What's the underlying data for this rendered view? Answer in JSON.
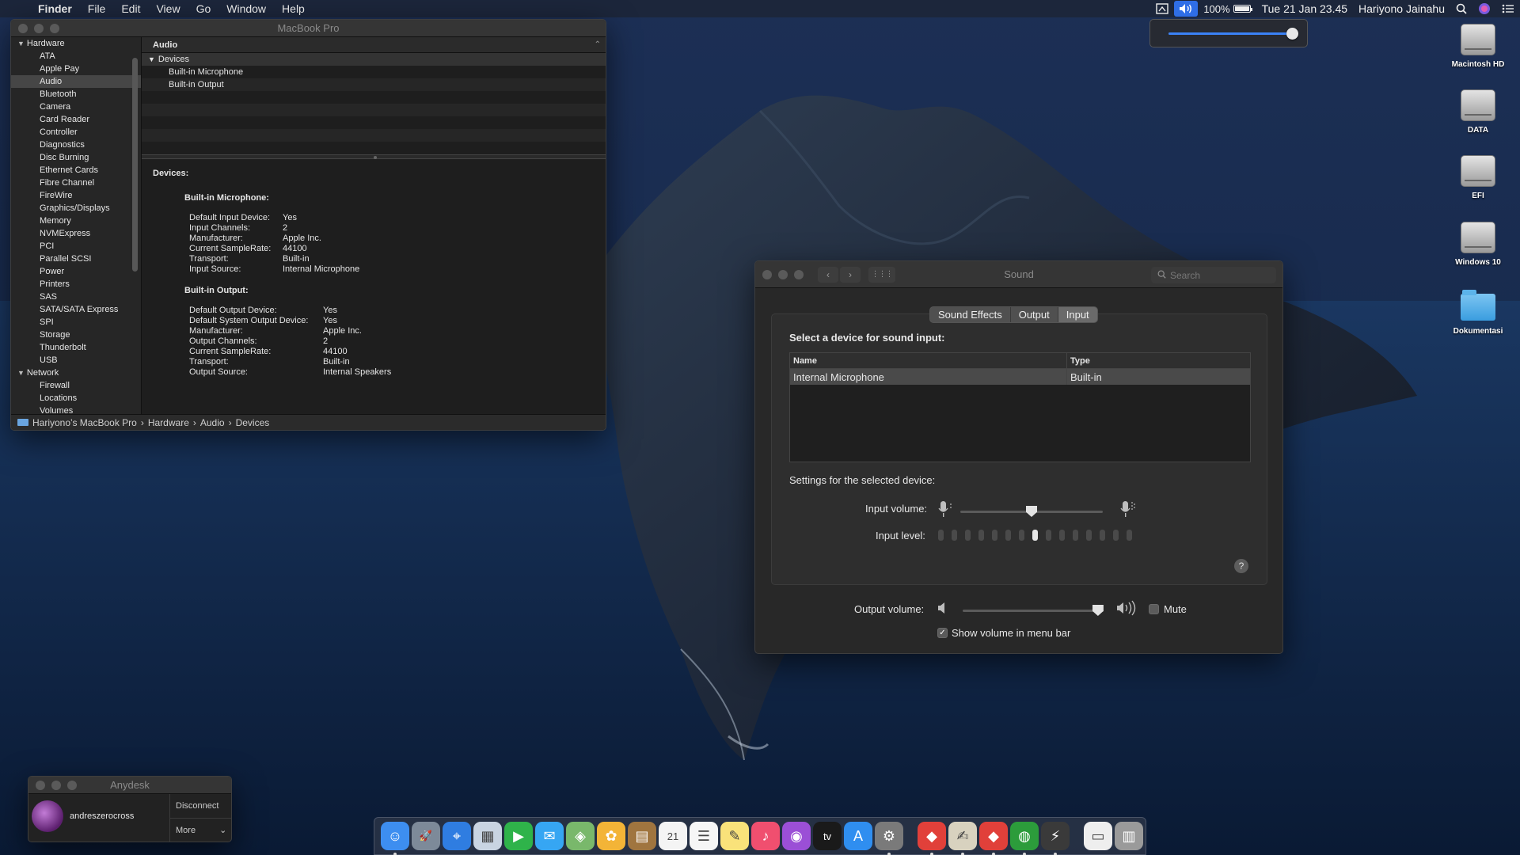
{
  "menubar": {
    "apple": "",
    "items": [
      "Finder",
      "File",
      "Edit",
      "View",
      "Go",
      "Window",
      "Help"
    ],
    "battery": "100%",
    "datetime": "Tue 21 Jan  23.45",
    "user": "Hariyono Jainahu"
  },
  "volume_popup": {
    "level": 0.96
  },
  "desktop_icons": [
    {
      "label": "Macintosh HD",
      "icon": "disk-icon"
    },
    {
      "label": "DATA",
      "icon": "disk-icon"
    },
    {
      "label": "EFI",
      "icon": "disk-icon"
    },
    {
      "label": "Windows 10",
      "icon": "disk-icon"
    },
    {
      "label": "Dokumentasi",
      "icon": "folder-icon"
    }
  ],
  "sysinfo": {
    "title": "MacBook Pro",
    "sidebar": {
      "hardware_label": "Hardware",
      "hardware_items": [
        "ATA",
        "Apple Pay",
        "Audio",
        "Bluetooth",
        "Camera",
        "Card Reader",
        "Controller",
        "Diagnostics",
        "Disc Burning",
        "Ethernet Cards",
        "Fibre Channel",
        "FireWire",
        "Graphics/Displays",
        "Memory",
        "NVMExpress",
        "PCI",
        "Parallel SCSI",
        "Power",
        "Printers",
        "SAS",
        "SATA/SATA Express",
        "SPI",
        "Storage",
        "Thunderbolt",
        "USB"
      ],
      "selected": "Audio",
      "network_label": "Network",
      "network_items": [
        "Firewall",
        "Locations",
        "Volumes"
      ]
    },
    "table": {
      "header": "Audio",
      "group": "Devices",
      "rows": [
        "Built-in Microphone",
        "Built-in Output"
      ]
    },
    "detail": {
      "heading": "Devices:",
      "mic_title": "Built-in Microphone:",
      "mic": [
        [
          "Default Input Device:",
          "Yes"
        ],
        [
          "Input Channels:",
          "2"
        ],
        [
          "Manufacturer:",
          "Apple Inc."
        ],
        [
          "Current SampleRate:",
          "44100"
        ],
        [
          "Transport:",
          "Built-in"
        ],
        [
          "Input Source:",
          "Internal Microphone"
        ]
      ],
      "out_title": "Built-in Output:",
      "out": [
        [
          "Default Output Device:",
          "Yes"
        ],
        [
          "Default System Output Device:",
          "Yes"
        ],
        [
          "Manufacturer:",
          "Apple Inc."
        ],
        [
          "Output Channels:",
          "2"
        ],
        [
          "Current SampleRate:",
          "44100"
        ],
        [
          "Transport:",
          "Built-in"
        ],
        [
          "Output Source:",
          "Internal Speakers"
        ]
      ]
    },
    "path": [
      "Hariyono’s MacBook Pro",
      "Hardware",
      "Audio",
      "Devices"
    ]
  },
  "sound": {
    "title": "Sound",
    "search_placeholder": "Search",
    "tabs": [
      "Sound Effects",
      "Output",
      "Input"
    ],
    "active_tab": "Input",
    "select_label": "Select a device for sound input:",
    "col_name": "Name",
    "col_type": "Type",
    "device_name": "Internal Microphone",
    "device_type": "Built-in",
    "settings_label": "Settings for the selected device:",
    "input_volume_label": "Input volume:",
    "input_volume": 0.5,
    "input_level_label": "Input level:",
    "input_level_segments": 15,
    "input_level_active": 7,
    "help": "?",
    "output_volume_label": "Output volume:",
    "output_volume": 0.96,
    "mute_label": "Mute",
    "mute_checked": false,
    "show_volume_label": "Show volume in menu bar",
    "show_volume_checked": true
  },
  "anydesk": {
    "title": "Anydesk",
    "user": "andreszerocross",
    "disconnect": "Disconnect",
    "more": "More"
  },
  "dock": {
    "apps": [
      {
        "name": "finder-icon",
        "color": "#3d8ef0",
        "glyph": "☺",
        "running": true
      },
      {
        "name": "launchpad-icon",
        "color": "#7d8a99",
        "glyph": "🚀",
        "running": false
      },
      {
        "name": "safari-icon",
        "color": "#2f7de1",
        "glyph": "⌖",
        "running": false
      },
      {
        "name": "preview-icon",
        "color": "#c9d4e2",
        "glyph": "▦",
        "running": false
      },
      {
        "name": "facetime-icon",
        "color": "#2fb34a",
        "glyph": "▶",
        "running": false
      },
      {
        "name": "messages-icon",
        "color": "#36a6f3",
        "glyph": "✉",
        "running": false
      },
      {
        "name": "maps-icon",
        "color": "#79b86b",
        "glyph": "◈",
        "running": false
      },
      {
        "name": "photos-icon",
        "color": "#f3b437",
        "glyph": "✿",
        "running": false
      },
      {
        "name": "notes-book-icon",
        "color": "#a0753f",
        "glyph": "▤",
        "running": false
      },
      {
        "name": "calendar-icon",
        "color": "#f4f4f4",
        "glyph": "21",
        "running": false
      },
      {
        "name": "reminders-icon",
        "color": "#f6f6f6",
        "glyph": "☰",
        "running": false
      },
      {
        "name": "notes-icon",
        "color": "#f9e27a",
        "glyph": "✎",
        "running": false
      },
      {
        "name": "music-icon",
        "color": "#f04f6f",
        "glyph": "♪",
        "running": false
      },
      {
        "name": "podcasts-icon",
        "color": "#9b4fd6",
        "glyph": "◉",
        "running": false
      },
      {
        "name": "tv-icon",
        "color": "#1a1a1a",
        "glyph": "tv",
        "running": false
      },
      {
        "name": "app-store-icon",
        "color": "#2f8ef0",
        "glyph": "A",
        "running": false
      },
      {
        "name": "system-preferences-icon",
        "color": "#7a7a7a",
        "glyph": "⚙",
        "running": true
      },
      {
        "name": "anydesk-icon",
        "color": "#e1403a",
        "glyph": "◆",
        "running": true
      },
      {
        "name": "script-editor-icon",
        "color": "#d8d2bf",
        "glyph": "✍",
        "running": true
      },
      {
        "name": "anydesk-alt-icon",
        "color": "#e1403a",
        "glyph": "◆",
        "running": true
      },
      {
        "name": "globe-icon",
        "color": "#2c9c3b",
        "glyph": "◍",
        "running": true
      },
      {
        "name": "system-information-icon",
        "color": "#3a3a3a",
        "glyph": "⚡",
        "running": true
      },
      {
        "name": "documents-icon",
        "color": "#eeeeee",
        "glyph": "▭",
        "running": false
      },
      {
        "name": "trash-icon",
        "color": "#9a9a9a",
        "glyph": "▥",
        "running": false
      }
    ]
  }
}
